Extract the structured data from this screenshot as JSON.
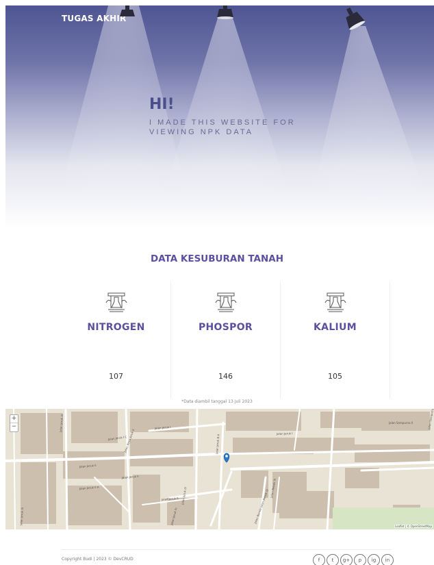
{
  "header": {
    "brand": "TUGAS AKHIR"
  },
  "hero": {
    "title": "HI!",
    "subtitle": "I MADE THIS WEBSITE FOR VIEWING NPK DATA"
  },
  "section": {
    "title": "DATA KESUBURAN TANAH",
    "cards": [
      {
        "title": "NITROGEN",
        "value": "107"
      },
      {
        "title": "PHOSPOR",
        "value": "146"
      },
      {
        "title": "KALIUM",
        "value": "105"
      }
    ],
    "note": "*Data diambil tanggal 13 Juli 2023"
  },
  "map": {
    "zoom_in": "+",
    "zoom_out": "−",
    "streets": [
      "Jalan Jeruk I",
      "Jalan Jeruk I",
      "Jalan Jeruk I C",
      "Jalan Raya Jeruk II",
      "Jalan Jeruk III",
      "Jalan Jeruk II",
      "Jalan Jeruk II",
      "Jalan Jeruk II A",
      "Jalan Jeruk II",
      "Jalan Jeruk III",
      "Jalan Jeruk III",
      "Jalan Jeruk IV",
      "Jalan Jeruk B A",
      "Jalan Benda Jalan Bebek III",
      "Jalan Bebek III",
      "Jalan Sempurna II",
      "Jalan Sempurna"
    ],
    "attribution": "Leaflet | © OpenStreetMap"
  },
  "footer": {
    "copyright": "Copyright Budi | 2023 © DevCRUD",
    "socials": [
      "f",
      "t",
      "g+",
      "p",
      "ig",
      "in"
    ]
  },
  "colors": {
    "accent": "#5b50a0",
    "hero_top": "#4f5592"
  }
}
